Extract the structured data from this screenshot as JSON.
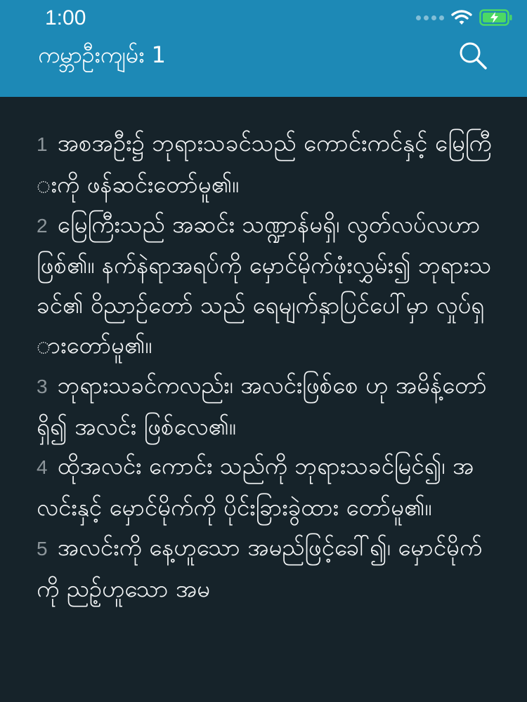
{
  "status_bar": {
    "time": "1:00"
  },
  "header": {
    "title": "ကမ္ဘာဦးကျမ်း 1",
    "search_icon": "search-icon"
  },
  "colors": {
    "header_bg": "#1d89b6",
    "content_bg": "#16232a",
    "verse_text": "#f5f7f8",
    "verse_number": "#8d969b",
    "battery": "#4cd964"
  },
  "verses": [
    {
      "num": "1",
      "text": "အစအဦး၌ ဘုရားသခင်သည် ကောင်းကင်နှင့် မြေကြီးကို ဖန်ဆင်းတော်မူ၏။"
    },
    {
      "num": "2",
      "text": "မြေကြီးသည် အဆင်း သဏ္ဍာန်မရှိ၊ လွတ်လပ်လဟာဖြစ်၏။ နက်နဲရာအရပ်ကို မှောင်မိုက်ဖုံးလွှမ်း၍ ဘုရားသခင်၏ ဝိညာဉ်တော် သည် ရေမျက်နှာပြင်ပေါ်မှာ လှုပ်ရှားတော်မူ၏။"
    },
    {
      "num": "3",
      "text": "ဘုရားသခင်ကလည်း၊ အလင်းဖြစ်စေ ဟု အမိန့်တော်ရှိ၍ အလင်း ဖြစ်လေ၏။"
    },
    {
      "num": "4",
      "text": "ထိုအလင်း ကောင်း သည်ကို ဘုရားသခင်မြင်၍၊ အလင်းနှင့် မှောင်မိုက်ကို ပိုင်းခြားခွဲထား တော်မူ၏။"
    },
    {
      "num": "5",
      "text": "အလင်းကို နေ့ဟူသော အမည်ဖြင့်ခေါ်၍၊ မှောင်မိုက်ကို ညဥ့်ဟူသော အမ"
    }
  ]
}
